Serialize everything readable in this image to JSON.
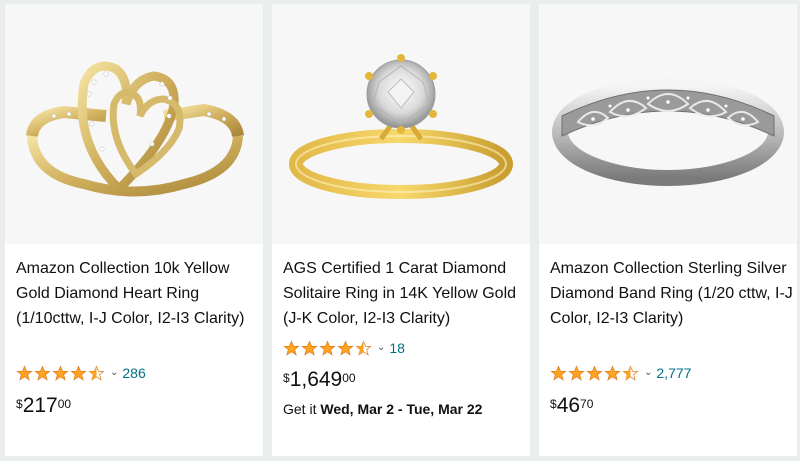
{
  "products": [
    {
      "title": "Amazon Collection 10k Yellow Gold Diamond Heart Ring (1/10cttw, I-J Color, I2-I3 Clarity)",
      "rating": 4.5,
      "review_count": "286",
      "price_symbol": "$",
      "price_whole": "217",
      "price_fraction": "00",
      "image_icon": "gold-heart-ring-image"
    },
    {
      "title": "AGS Certified 1 Carat Diamond Solitaire Ring in 14K Yellow Gold (J-K Color, I2-I3 Clarity)",
      "rating": 4.5,
      "review_count": "18",
      "price_symbol": "$",
      "price_whole": "1,649",
      "price_fraction": "00",
      "delivery_prefix": "Get it ",
      "delivery_dates": "Wed, Mar 2 - Tue, Mar 22",
      "image_icon": "solitaire-ring-image"
    },
    {
      "title": "Amazon Collection Sterling Silver Diamond Band Ring (1/20 cttw, I-J Color, I2-I3 Clarity)",
      "rating": 4.5,
      "review_count": "2,777",
      "price_symbol": "$",
      "price_whole": "46",
      "price_fraction": "70",
      "image_icon": "silver-band-ring-image"
    }
  ],
  "colors": {
    "star": "#ffa41c",
    "star_outline": "#de7921",
    "link": "#007185",
    "page_bg": "#eaeded",
    "image_bg": "#f7f7f7"
  }
}
